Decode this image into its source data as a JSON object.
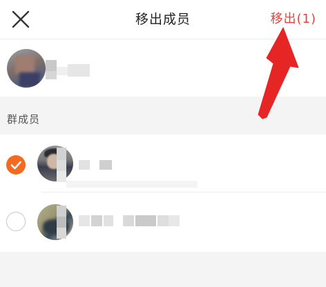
{
  "header": {
    "title": "移出成员",
    "remove_label": "移出(1)"
  },
  "section": {
    "label": "群成员"
  },
  "members": [
    {
      "selected": true
    },
    {
      "selected": false
    }
  ],
  "icons": {
    "close": "close-icon",
    "check": "check-icon",
    "arrow": "red-arrow-annotation"
  },
  "colors": {
    "accent": "#e8413a",
    "checkbox_active": "#f46a21"
  }
}
